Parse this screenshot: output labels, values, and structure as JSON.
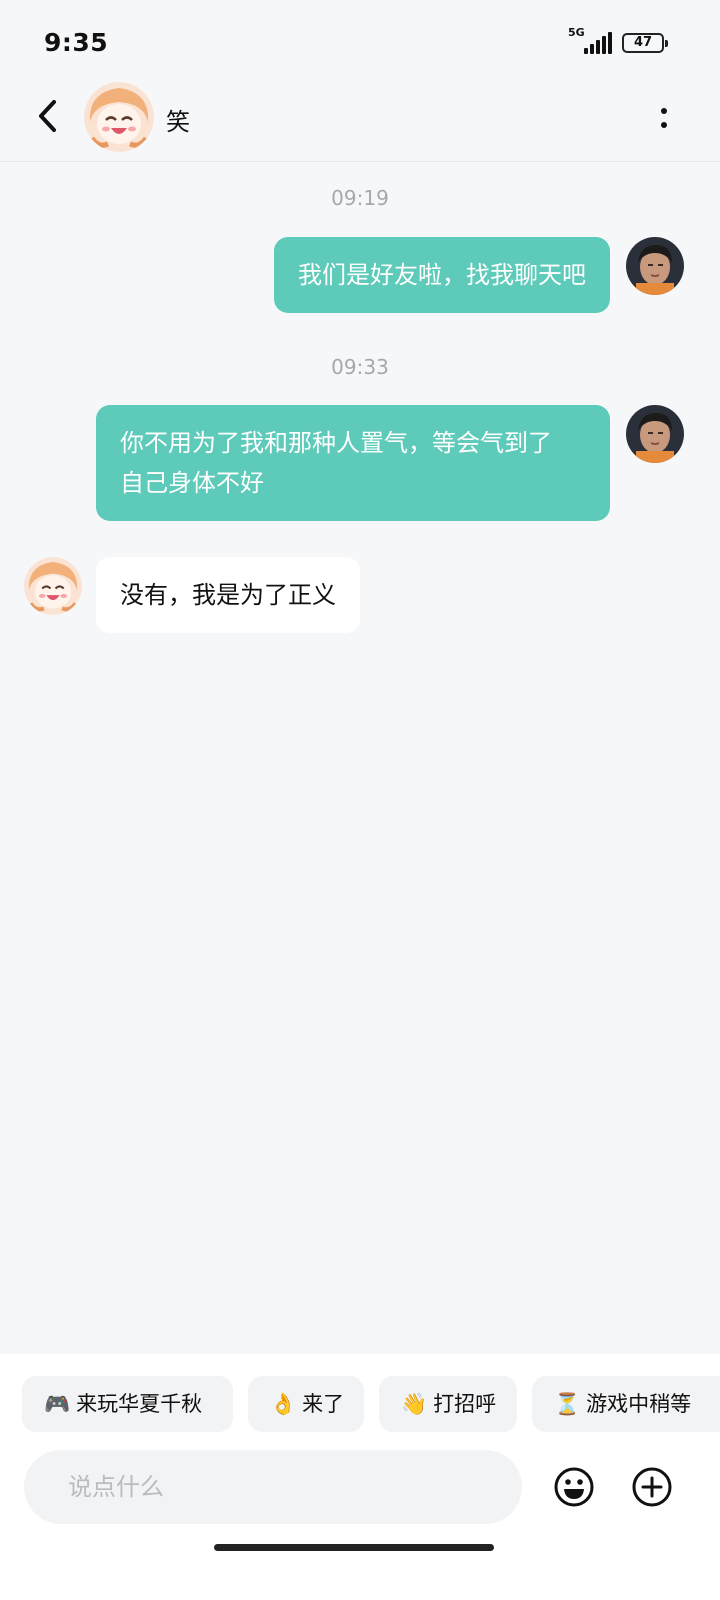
{
  "status": {
    "time": "9:35",
    "network": "5G",
    "battery": "47"
  },
  "header": {
    "title": "笑",
    "back_icon": "chevron-left-icon",
    "more_icon": "more-vertical-icon"
  },
  "messages": [
    {
      "time": "09:19",
      "direction": "out",
      "text": "我们是好友啦，找我聊天吧"
    },
    {
      "time": "09:33",
      "direction": "out",
      "text_line1": "你不用为了我和那种人置气，等会气到了",
      "text_line2": "自己身体不好"
    },
    {
      "direction": "in",
      "text": "没有，我是为了正义"
    }
  ],
  "quick_replies": [
    {
      "emoji": "🎮",
      "label": "来玩华夏千秋"
    },
    {
      "emoji": "👌",
      "label": "来了"
    },
    {
      "emoji": "👋",
      "label": "打招呼"
    },
    {
      "emoji": "⏳",
      "label": "游戏中稍等"
    }
  ],
  "composer": {
    "placeholder": "说点什么",
    "emoji_icon": "smiley-icon",
    "plus_icon": "plus-circle-icon"
  },
  "colors": {
    "accent": "#5ecab9",
    "background": "#f6f7f9"
  }
}
